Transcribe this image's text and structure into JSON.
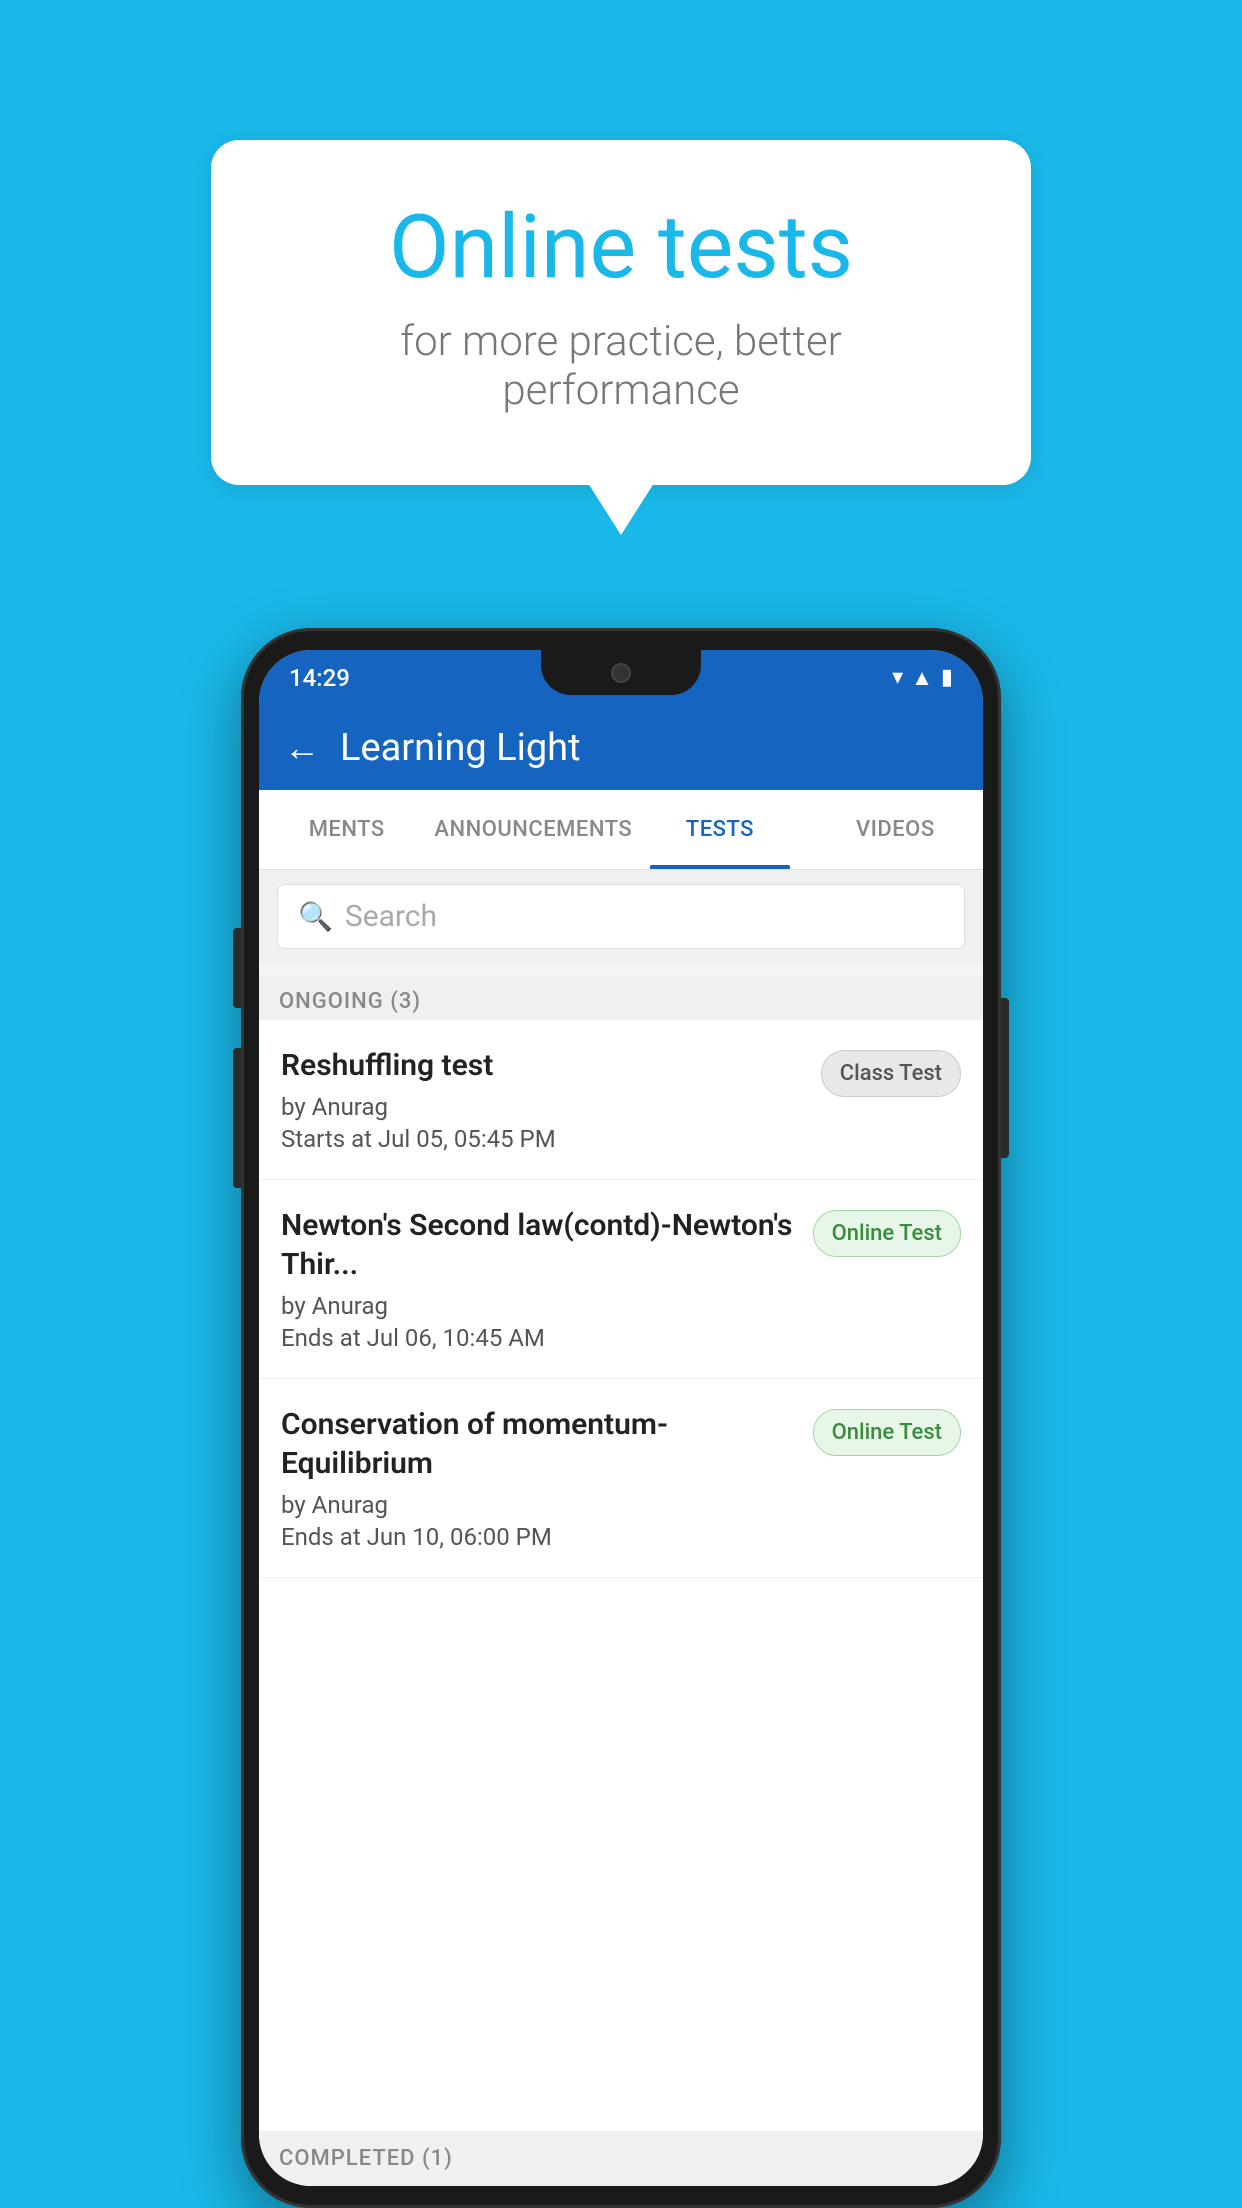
{
  "background_color": "#1ab8e8",
  "bubble": {
    "title": "Online tests",
    "subtitle": "for more practice, better performance"
  },
  "phone": {
    "status_bar": {
      "time": "14:29",
      "icons": [
        "wifi",
        "signal",
        "battery"
      ]
    },
    "header": {
      "title": "Learning Light",
      "back_label": "←"
    },
    "tabs": [
      {
        "label": "MENTS",
        "active": false
      },
      {
        "label": "ANNOUNCEMENTS",
        "active": false
      },
      {
        "label": "TESTS",
        "active": true
      },
      {
        "label": "VIDEOS",
        "active": false
      }
    ],
    "search": {
      "placeholder": "Search"
    },
    "ongoing_section": {
      "label": "ONGOING (3)"
    },
    "tests": [
      {
        "name": "Reshuffling test",
        "author": "by Anurag",
        "date": "Starts at  Jul 05, 05:45 PM",
        "tag": "Class Test",
        "tag_type": "class"
      },
      {
        "name": "Newton's Second law(contd)-Newton's Thir...",
        "author": "by Anurag",
        "date": "Ends at  Jul 06, 10:45 AM",
        "tag": "Online Test",
        "tag_type": "online"
      },
      {
        "name": "Conservation of momentum-Equilibrium",
        "author": "by Anurag",
        "date": "Ends at  Jun 10, 06:00 PM",
        "tag": "Online Test",
        "tag_type": "online"
      }
    ],
    "completed_section": {
      "label": "COMPLETED (1)"
    }
  }
}
